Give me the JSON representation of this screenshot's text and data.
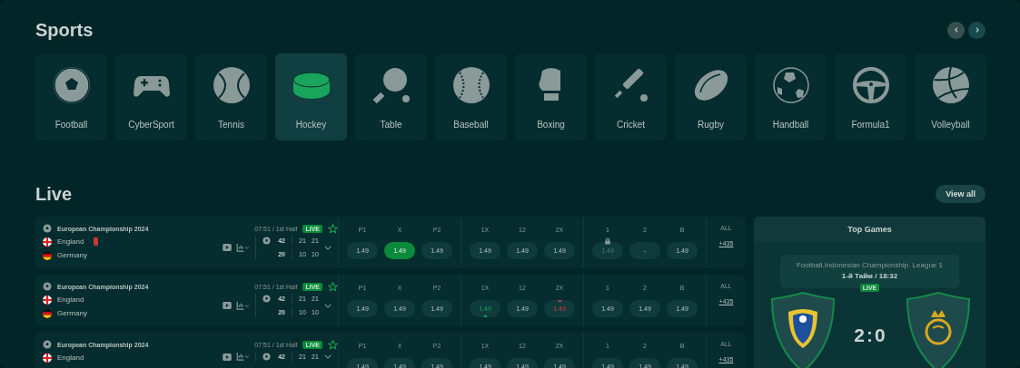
{
  "sports": {
    "title": "Sports",
    "nav": [
      {
        "kind": "prev",
        "disabled": true
      },
      {
        "kind": "next",
        "disabled": false
      }
    ],
    "items": [
      {
        "label": "Football",
        "selected": false
      },
      {
        "label": "CyberSport",
        "selected": false
      },
      {
        "label": "Tennis",
        "selected": false
      },
      {
        "label": "Hockey",
        "selected": true
      },
      {
        "label": "Table",
        "selected": false
      },
      {
        "label": "Baseball",
        "selected": false
      },
      {
        "label": "Boxing",
        "selected": false
      },
      {
        "label": "Cricket",
        "selected": false
      },
      {
        "label": "Rugby",
        "selected": false
      },
      {
        "label": "Handball",
        "selected": false
      },
      {
        "label": "Formula1",
        "selected": false
      },
      {
        "label": "Volleyball",
        "selected": false
      }
    ]
  },
  "live": {
    "title": "Live",
    "view_all": "View all",
    "matches": [
      {
        "league": "European Championship 2024",
        "time": "07:51 / 1st Half",
        "badge": "LIVE",
        "favorite": false,
        "teams": [
          {
            "name": "England",
            "red_card": true
          },
          {
            "name": "Germany",
            "red_card": false
          }
        ],
        "score": [
          {
            "total": "42",
            "sets": [
              "21",
              "21"
            ]
          },
          {
            "total": "20",
            "sets": [
              "10",
              "10"
            ]
          }
        ],
        "markets": [
          [
            {
              "label": "P1",
              "value": "1.49",
              "selected": false,
              "locked": false,
              "rising": false,
              "falling": false
            },
            {
              "label": "X",
              "value": "1.49",
              "selected": true,
              "locked": false,
              "rising": false,
              "falling": false
            },
            {
              "label": "P2",
              "value": "1.49",
              "selected": false,
              "locked": false,
              "rising": false,
              "falling": false
            }
          ],
          [
            {
              "label": "1X",
              "value": "1.49",
              "selected": false,
              "locked": false,
              "rising": false,
              "falling": false
            },
            {
              "label": "12",
              "value": "1.49",
              "selected": false,
              "locked": false,
              "rising": false,
              "falling": false
            },
            {
              "label": "2X",
              "value": "1.49",
              "selected": false,
              "locked": false,
              "rising": false,
              "falling": false
            }
          ],
          [
            {
              "label": "1",
              "value": "1.49",
              "selected": false,
              "locked": true,
              "rising": false,
              "falling": false
            },
            {
              "label": "2",
              "value": "-",
              "selected": false,
              "locked": false,
              "rising": false,
              "falling": false
            },
            {
              "label": "B",
              "value": "1.49",
              "selected": false,
              "locked": false,
              "rising": false,
              "falling": false
            }
          ]
        ],
        "all_label": "ALL",
        "all_count": "+435"
      },
      {
        "league": "European Championship 2024",
        "time": "07:51 / 1st Half",
        "badge": "LIVE",
        "favorite": false,
        "teams": [
          {
            "name": "England",
            "red_card": false
          },
          {
            "name": "Germany",
            "red_card": false
          }
        ],
        "score": [
          {
            "total": "42",
            "sets": [
              "21",
              "21"
            ]
          },
          {
            "total": "20",
            "sets": [
              "10",
              "10"
            ]
          }
        ],
        "markets": [
          [
            {
              "label": "P1",
              "value": "1.49",
              "selected": false,
              "locked": false,
              "rising": false,
              "falling": false
            },
            {
              "label": "X",
              "value": "1.49",
              "selected": false,
              "locked": false,
              "rising": false,
              "falling": false
            },
            {
              "label": "P2",
              "value": "1.49",
              "selected": false,
              "locked": false,
              "rising": false,
              "falling": false
            }
          ],
          [
            {
              "label": "1X",
              "value": "1.49",
              "selected": false,
              "locked": false,
              "rising": true,
              "falling": false
            },
            {
              "label": "12",
              "value": "1.49",
              "selected": false,
              "locked": false,
              "rising": false,
              "falling": false
            },
            {
              "label": "2X",
              "value": "1.49",
              "selected": false,
              "locked": false,
              "rising": false,
              "falling": true
            }
          ],
          [
            {
              "label": "1",
              "value": "1.49",
              "selected": false,
              "locked": false,
              "rising": false,
              "falling": false
            },
            {
              "label": "2",
              "value": "1.49",
              "selected": false,
              "locked": false,
              "rising": false,
              "falling": false
            },
            {
              "label": "B",
              "value": "1.49",
              "selected": false,
              "locked": false,
              "rising": false,
              "falling": false
            }
          ]
        ],
        "all_label": "ALL",
        "all_count": "+435"
      },
      {
        "league": "European Championship 2024",
        "time": "07:51 / 1st Half",
        "badge": "LIVE",
        "favorite": false,
        "teams": [
          {
            "name": "England",
            "red_card": false
          }
        ],
        "score": [
          {
            "total": "42",
            "sets": [
              "21",
              "21"
            ]
          }
        ],
        "markets": [
          [
            {
              "label": "P1",
              "value": "1.49",
              "selected": false,
              "locked": false,
              "rising": false,
              "falling": false
            },
            {
              "label": "X",
              "value": "1.49",
              "selected": false,
              "locked": false,
              "rising": false,
              "falling": false
            },
            {
              "label": "P2",
              "value": "1.49",
              "selected": false,
              "locked": false,
              "rising": false,
              "falling": false
            }
          ],
          [
            {
              "label": "1X",
              "value": "1.49",
              "selected": false,
              "locked": false,
              "rising": false,
              "falling": false
            },
            {
              "label": "12",
              "value": "1.49",
              "selected": false,
              "locked": false,
              "rising": false,
              "falling": false
            },
            {
              "label": "2X",
              "value": "1.49",
              "selected": false,
              "locked": false,
              "rising": false,
              "falling": false
            }
          ],
          [
            {
              "label": "1",
              "value": "1.49",
              "selected": false,
              "locked": false,
              "rising": false,
              "falling": false
            },
            {
              "label": "2",
              "value": "1.49",
              "selected": false,
              "locked": false,
              "rising": false,
              "falling": false
            },
            {
              "label": "B",
              "value": "1.49",
              "selected": false,
              "locked": false,
              "rising": false,
              "falling": false
            }
          ]
        ],
        "all_label": "ALL",
        "all_count": "+435"
      }
    ]
  },
  "top_games": {
    "title": "Top Games",
    "league": "Football.Indonesian Championship. League 1",
    "period": "1-й Тайм / 18:32",
    "badge": "LIVE",
    "score": "2:0"
  }
}
